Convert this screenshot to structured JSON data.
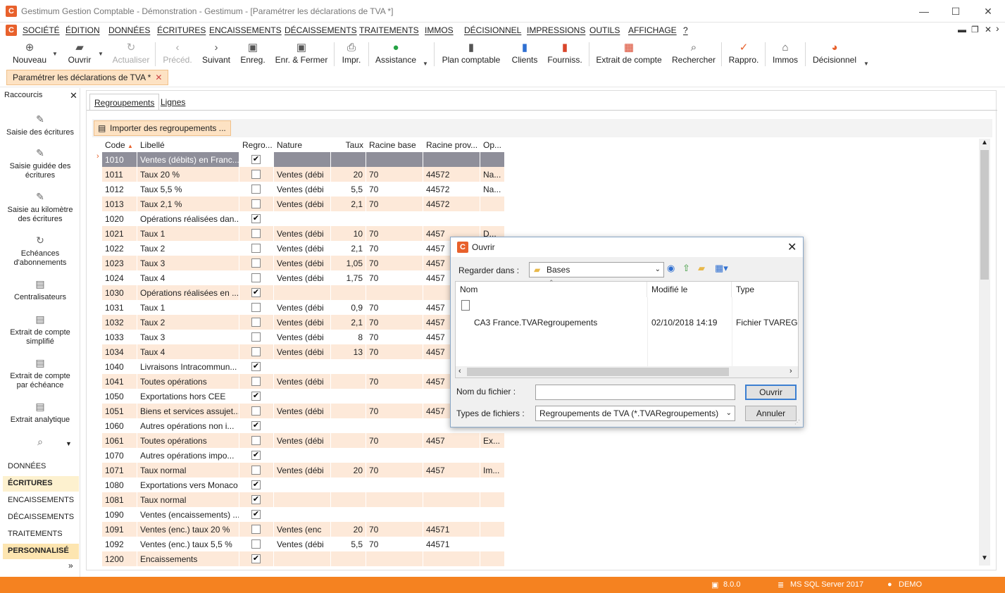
{
  "window": {
    "title": "Gestimum Gestion Comptable - Démonstration - Gestimum - [Paramétrer les déclarations de TVA *]",
    "logo_letter": "C"
  },
  "menu": [
    "SOCIÉTÉ",
    "ÉDITION",
    "DONNÉES",
    "ÉCRITURES",
    "ENCAISSEMENTS",
    "DÉCAISSEMENTS",
    "TRAITEMENTS",
    "IMMOS",
    "DÉCISIONNEL",
    "IMPRESSIONS",
    "OUTILS",
    "AFFICHAGE",
    "?"
  ],
  "toolbar": {
    "nouveau": "Nouveau",
    "ouvrir": "Ouvrir",
    "actualiser": "Actualiser",
    "preced": "Précéd.",
    "suivant": "Suivant",
    "enreg": "Enreg.",
    "enreg_fermer": "Enr. & Fermer",
    "impr": "Impr.",
    "assistance": "Assistance",
    "plan_comptable": "Plan comptable",
    "clients": "Clients",
    "fourniss": "Fourniss.",
    "extrait": "Extrait de compte",
    "rechercher": "Rechercher",
    "rappro": "Rappro.",
    "immos": "Immos",
    "decisionnel": "Décisionnel"
  },
  "doc_tab": "Paramétrer les déclarations de TVA *",
  "sidebar": {
    "title": "Raccourcis",
    "shortcuts": [
      "Saisie des écritures",
      "Saisie guidée des écritures",
      "Saisie au kilomètre des écritures",
      "Echéances d'abonnements",
      "Centralisateurs",
      "Extrait de compte simplifié",
      "Extrait de compte par échéance",
      "Extrait analytique"
    ],
    "sections": [
      "DONNÉES",
      "ÉCRITURES",
      "ENCAISSEMENTS",
      "DÉCAISSEMENTS",
      "TRAITEMENTS",
      "PERSONNALISÉ"
    ]
  },
  "tabs": {
    "regroupements": "Regroupements",
    "lignes": "Lignes"
  },
  "import_button": "Importer des regroupements ...",
  "grid": {
    "headers": {
      "code": "Code",
      "libelle": "Libellé",
      "regro": "Regro...",
      "nature": "Nature",
      "taux": "Taux",
      "racine_base": "Racine base",
      "racine_prov": "Racine prov...",
      "op": "Op..."
    },
    "rows": [
      {
        "code": "1010",
        "libelle": "Ventes (débits) en Franc...",
        "regro": true,
        "nature": "",
        "taux": "",
        "rb": "",
        "rp": "",
        "op": ""
      },
      {
        "code": "1011",
        "libelle": "Taux  20 %",
        "regro": false,
        "nature": "Ventes (débi",
        "taux": "20",
        "rb": "70",
        "rp": "44572",
        "op": "Na..."
      },
      {
        "code": "1012",
        "libelle": "Taux 5,5 %",
        "regro": false,
        "nature": "Ventes (débi",
        "taux": "5,5",
        "rb": "70",
        "rp": "44572",
        "op": "Na..."
      },
      {
        "code": "1013",
        "libelle": "Taux 2,1 %",
        "regro": false,
        "nature": "Ventes (débi",
        "taux": "2,1",
        "rb": "70",
        "rp": "44572",
        "op": ""
      },
      {
        "code": "1020",
        "libelle": "Opérations réalisées dan...",
        "regro": true,
        "nature": "",
        "taux": "",
        "rb": "",
        "rp": "",
        "op": ""
      },
      {
        "code": "1021",
        "libelle": "Taux 1",
        "regro": false,
        "nature": "Ventes (débi",
        "taux": "10",
        "rb": "70",
        "rp": "4457",
        "op": "D..."
      },
      {
        "code": "1022",
        "libelle": "Taux 2",
        "regro": false,
        "nature": "Ventes (débi",
        "taux": "2,1",
        "rb": "70",
        "rp": "4457",
        "op": ""
      },
      {
        "code": "1023",
        "libelle": "Taux 3",
        "regro": false,
        "nature": "Ventes (débi",
        "taux": "1,05",
        "rb": "70",
        "rp": "4457",
        "op": ""
      },
      {
        "code": "1024",
        "libelle": "Taux 4",
        "regro": false,
        "nature": "Ventes (débi",
        "taux": "1,75",
        "rb": "70",
        "rp": "4457",
        "op": ""
      },
      {
        "code": "1030",
        "libelle": "Opérations réalisées en ...",
        "regro": true,
        "nature": "",
        "taux": "",
        "rb": "",
        "rp": "",
        "op": ""
      },
      {
        "code": "1031",
        "libelle": "Taux 1",
        "regro": false,
        "nature": "Ventes (débi",
        "taux": "0,9",
        "rb": "70",
        "rp": "4457",
        "op": ""
      },
      {
        "code": "1032",
        "libelle": "Taux 2",
        "regro": false,
        "nature": "Ventes (débi",
        "taux": "2,1",
        "rb": "70",
        "rp": "4457",
        "op": ""
      },
      {
        "code": "1033",
        "libelle": "Taux 3",
        "regro": false,
        "nature": "Ventes (débi",
        "taux": "8",
        "rb": "70",
        "rp": "4457",
        "op": ""
      },
      {
        "code": "1034",
        "libelle": "Taux 4",
        "regro": false,
        "nature": "Ventes (débi",
        "taux": "13",
        "rb": "70",
        "rp": "4457",
        "op": ""
      },
      {
        "code": "1040",
        "libelle": "Livraisons Intracommun...",
        "regro": true,
        "nature": "",
        "taux": "",
        "rb": "",
        "rp": "",
        "op": ""
      },
      {
        "code": "1041",
        "libelle": "Toutes opérations",
        "regro": false,
        "nature": "Ventes (débi",
        "taux": "",
        "rb": "70",
        "rp": "4457",
        "op": ""
      },
      {
        "code": "1050",
        "libelle": "Exportations hors CEE",
        "regro": true,
        "nature": "",
        "taux": "",
        "rb": "",
        "rp": "",
        "op": ""
      },
      {
        "code": "1051",
        "libelle": "Biens et services assujet...",
        "regro": false,
        "nature": "Ventes (débi",
        "taux": "",
        "rb": "70",
        "rp": "4457",
        "op": ""
      },
      {
        "code": "1060",
        "libelle": "Autres opérations non i...",
        "regro": true,
        "nature": "",
        "taux": "",
        "rb": "",
        "rp": "",
        "op": ""
      },
      {
        "code": "1061",
        "libelle": "Toutes opérations",
        "regro": false,
        "nature": "Ventes (débi",
        "taux": "",
        "rb": "70",
        "rp": "4457",
        "op": "Ex..."
      },
      {
        "code": "1070",
        "libelle": "Autres opérations impo...",
        "regro": true,
        "nature": "",
        "taux": "",
        "rb": "",
        "rp": "",
        "op": ""
      },
      {
        "code": "1071",
        "libelle": "Taux normal",
        "regro": false,
        "nature": "Ventes (débi",
        "taux": "20",
        "rb": "70",
        "rp": "4457",
        "op": "Im..."
      },
      {
        "code": "1080",
        "libelle": "Exportations vers Monaco",
        "regro": true,
        "nature": "",
        "taux": "",
        "rb": "",
        "rp": "",
        "op": ""
      },
      {
        "code": "1081",
        "libelle": "Taux normal",
        "regro": true,
        "nature": "",
        "taux": "",
        "rb": "",
        "rp": "",
        "op": ""
      },
      {
        "code": "1090",
        "libelle": "Ventes (encaissements) ...",
        "regro": true,
        "nature": "",
        "taux": "",
        "rb": "",
        "rp": "",
        "op": ""
      },
      {
        "code": "1091",
        "libelle": "Ventes (enc.) taux 20 %",
        "regro": false,
        "nature": "Ventes (enc",
        "taux": "20",
        "rb": "70",
        "rp": "44571",
        "op": ""
      },
      {
        "code": "1092",
        "libelle": "Ventes (enc.) taux 5,5 %",
        "regro": false,
        "nature": "Ventes (débi",
        "taux": "5,5",
        "rb": "70",
        "rp": "44571",
        "op": ""
      },
      {
        "code": "1200",
        "libelle": "Encaissements",
        "regro": true,
        "nature": "",
        "taux": "",
        "rb": "",
        "rp": "",
        "op": ""
      }
    ]
  },
  "dialog": {
    "title": "Ouvrir",
    "look_in_label": "Regarder dans :",
    "look_in_value": "Bases",
    "columns": {
      "name": "Nom",
      "modified": "Modifié le",
      "type": "Type"
    },
    "file": {
      "name": "CA3 France.TVARegroupements",
      "modified": "02/10/2018 14:19",
      "type": "Fichier TVAREGR"
    },
    "filename_label": "Nom du fichier :",
    "filename_value": "",
    "filetype_label": "Types de fichiers :",
    "filetype_value": "Regroupements de TVA (*.TVARegroupements)",
    "open_button": "Ouvrir",
    "cancel_button": "Annuler"
  },
  "status": {
    "version": "8.0.0",
    "server": "MS SQL Server 2017",
    "user": "DEMO"
  },
  "colors": {
    "accent": "#f58220",
    "row_alt": "#fde9d9",
    "selected_row": "#8f8f9a"
  }
}
